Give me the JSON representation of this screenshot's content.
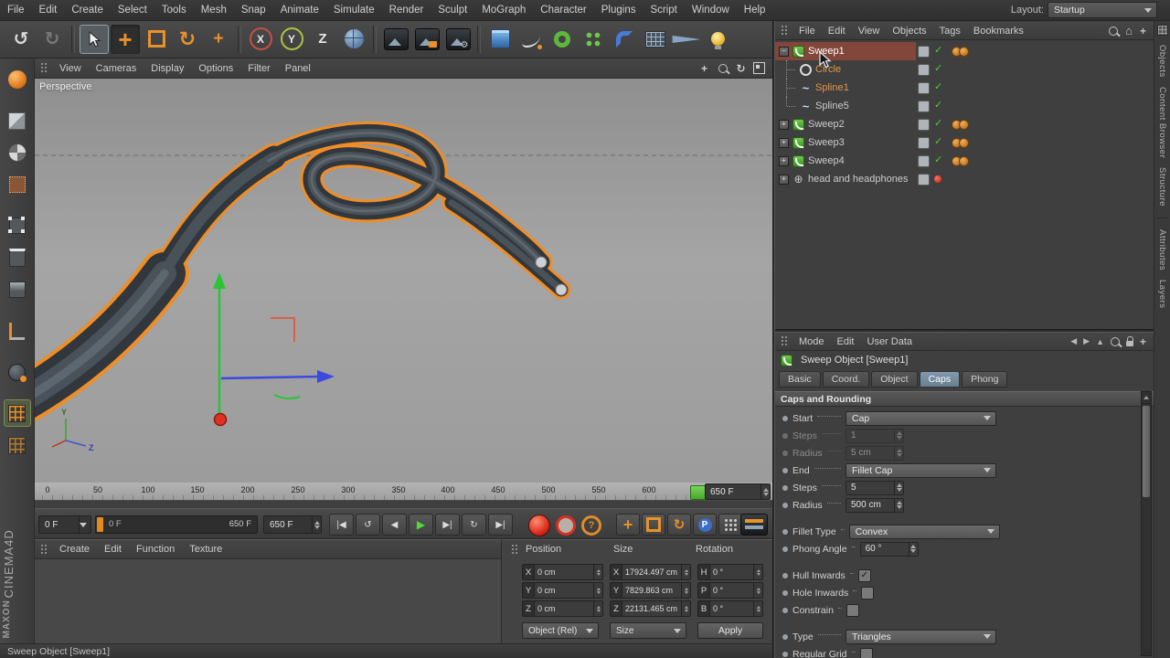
{
  "menubar": {
    "items": [
      "File",
      "Edit",
      "Create",
      "Select",
      "Tools",
      "Mesh",
      "Snap",
      "Animate",
      "Simulate",
      "Render",
      "Sculpt",
      "MoGraph",
      "Character",
      "Plugins",
      "Script",
      "Window",
      "Help"
    ],
    "layout_label": "Layout:",
    "layout_value": "Startup"
  },
  "icons": {
    "undo": "↺",
    "redo": "↻",
    "rotate": "↻",
    "goto_start": "|◀",
    "loop_back": "↺",
    "play_backwards": "◀",
    "play": "▶",
    "play_next": "▶|",
    "loop": "↻",
    "goto_end": "▶|",
    "home": "⌂",
    "plus": "+",
    "nav_left": "◀",
    "nav_right": "▶",
    "arrow_mode": "▲",
    "question": "?",
    "key_plus": "+",
    "check": "✓"
  },
  "toolbar": {
    "axis_x": "X",
    "axis_y": "Y",
    "axis_z": "Z"
  },
  "viewport": {
    "menu_items": [
      "View",
      "Cameras",
      "Display",
      "Options",
      "Filter",
      "Panel"
    ],
    "view_label": "Perspective",
    "axis_y_label": "Y",
    "axis_z_label": "Z"
  },
  "timeline": {
    "ticks": [
      "0",
      "50",
      "100",
      "150",
      "200",
      "250",
      "300",
      "350",
      "400",
      "450",
      "500",
      "550",
      "600"
    ],
    "end_field": "650 F"
  },
  "animbar": {
    "current_frame": "0 F",
    "range_start": "0 F",
    "range_end": "650 F",
    "end_frame": "650 F",
    "parameter_label": "P"
  },
  "materials_panel": {
    "menu": [
      "Create",
      "Edit",
      "Function",
      "Texture"
    ]
  },
  "coordinates": {
    "headers": [
      "Position",
      "Size",
      "Rotation"
    ],
    "rows": [
      {
        "pl": "X",
        "pv": "0 cm",
        "sl": "X",
        "sv": "17924.497 cm",
        "rl": "H",
        "rv": "0 °"
      },
      {
        "pl": "Y",
        "pv": "0 cm",
        "sl": "Y",
        "sv": "7829.863 cm",
        "rl": "P",
        "rv": "0 °"
      },
      {
        "pl": "Z",
        "pv": "0 cm",
        "sl": "Z",
        "sv": "22131.465 cm",
        "rl": "B",
        "rv": "0 °"
      }
    ],
    "mode_dropdown": "Object (Rel)",
    "size_dropdown": "Size",
    "apply_label": "Apply"
  },
  "object_manager": {
    "menu": [
      "File",
      "Edit",
      "View",
      "Objects",
      "Tags",
      "Bookmarks"
    ],
    "items": [
      {
        "name": "Sweep1",
        "expander": "−",
        "check": "✓"
      },
      {
        "name": "Circle",
        "expander": "",
        "check": "✓"
      },
      {
        "name": "Spline1",
        "expander": "",
        "check": "✓"
      },
      {
        "name": "Spline5",
        "expander": "",
        "check": "✓"
      },
      {
        "name": "Sweep2",
        "expander": "+",
        "check": "✓"
      },
      {
        "name": "Sweep3",
        "expander": "+",
        "check": "✓"
      },
      {
        "name": "Sweep4",
        "expander": "+",
        "check": "✓"
      },
      {
        "name": "head and headphones",
        "expander": "+",
        "check": ""
      }
    ]
  },
  "attributes": {
    "menu": [
      "Mode",
      "Edit",
      "User Data"
    ],
    "title": "Sweep Object [Sweep1]",
    "tabs": [
      "Basic",
      "Coord.",
      "Object",
      "Caps",
      "Phong"
    ],
    "section": "Caps and Rounding",
    "rows": {
      "start": {
        "label": "Start",
        "value": "Cap"
      },
      "steps1": {
        "label": "Steps",
        "value": "1"
      },
      "radius1": {
        "label": "Radius",
        "value": "5 cm"
      },
      "end": {
        "label": "End",
        "value": "Fillet Cap"
      },
      "steps2": {
        "label": "Steps",
        "value": "5"
      },
      "radius2": {
        "label": "Radius",
        "value": "500 cm"
      },
      "fillet_type": {
        "label": "Fillet Type",
        "value": "Convex"
      },
      "phong_angle": {
        "label": "Phong Angle",
        "value": "60 °"
      },
      "hull_inwards": {
        "label": "Hull Inwards",
        "mark": "✓"
      },
      "hole_inwards": {
        "label": "Hole Inwards",
        "mark": ""
      },
      "constrain": {
        "label": "Constrain",
        "mark": ""
      },
      "type": {
        "label": "Type",
        "value": "Triangles"
      },
      "regular_grid": {
        "label": "Regular Grid",
        "mark": ""
      }
    }
  },
  "side_tabs": {
    "top": [
      "Objects",
      "Content Browser",
      "Structure"
    ],
    "bottom": [
      "Attributes",
      "Layers"
    ]
  },
  "statusbar": {
    "text": "Sweep Object [Sweep1]"
  },
  "brand": {
    "name": "MAXON",
    "product": "CINEMA4D"
  }
}
